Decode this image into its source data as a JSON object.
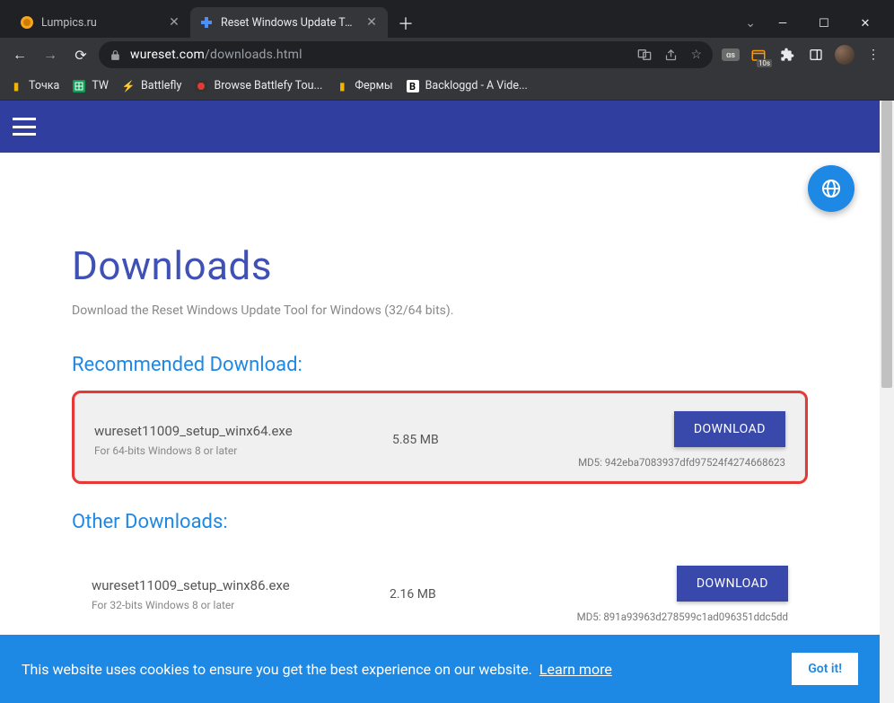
{
  "tabs": [
    {
      "title": "Lumpics.ru",
      "active": false
    },
    {
      "title": "Reset Windows Update Tool - Tro",
      "active": true
    }
  ],
  "address": {
    "domain": "wureset.com",
    "path": "/downloads.html"
  },
  "bookmarks": [
    {
      "label": "Точка"
    },
    {
      "label": "TW"
    },
    {
      "label": "Battlefly"
    },
    {
      "label": "Browse Battlefy Tou..."
    },
    {
      "label": "Фермы"
    },
    {
      "label": "Backloggd - A Vide..."
    }
  ],
  "page": {
    "title": "Downloads",
    "subtitle": "Download the Reset Windows Update Tool for Windows (32/64 bits).",
    "sections": {
      "recommended": "Recommended Download:",
      "other": "Other Downloads:"
    },
    "downloads": [
      {
        "name": "wureset11009_setup_winx64.exe",
        "desc": "For 64-bits Windows 8 or later",
        "size": "5.85 MB",
        "button": "DOWNLOAD",
        "md5": "MD5: 942eba7083937dfd97524f4274668623",
        "highlight": true
      },
      {
        "name": "wureset11009_setup_winx86.exe",
        "desc": "For 32-bits Windows 8 or later",
        "size": "2.16 MB",
        "button": "DOWNLOAD",
        "md5": "MD5: 891a93963d278599c1ad096351ddc5dd",
        "highlight": false
      }
    ]
  },
  "cookie": {
    "text": "This website uses cookies to ensure you get the best experience on our website.",
    "learn": "Learn more",
    "button": "Got it!"
  },
  "timer_badge": "10s"
}
